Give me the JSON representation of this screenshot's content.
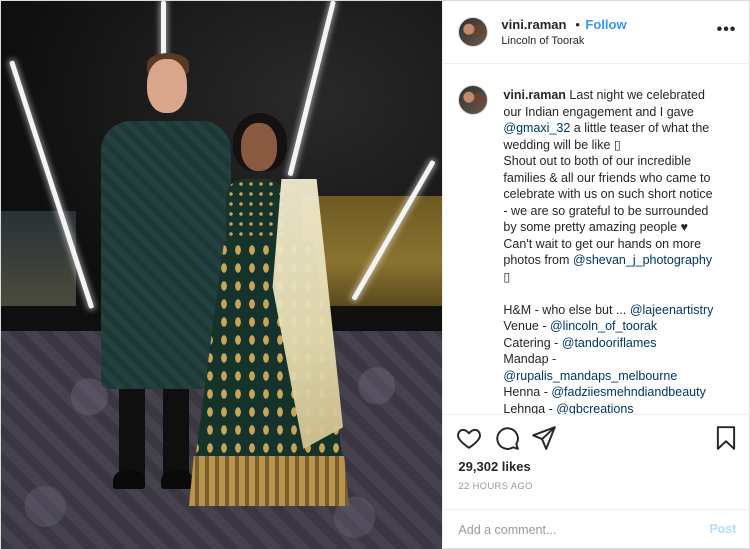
{
  "header": {
    "username": "vini.raman",
    "separator": "•",
    "follow_label": "Follow",
    "location": "Lincoln of Toorak",
    "more_glyph": "•••"
  },
  "caption": {
    "username": "vini.raman",
    "lines": [
      {
        "text": " Last night we celebrated"
      },
      {
        "text": "our Indian engagement and I gave"
      },
      {
        "mention": "@gmaxi_32",
        "text": " a little teaser of what the"
      },
      {
        "text": "wedding will be like ▯"
      },
      {
        "text": "Shout out to both of our incredible"
      },
      {
        "text": "families & all our friends who came to"
      },
      {
        "text": "celebrate with us on such short notice"
      },
      {
        "text": "- we are so grateful to be surrounded"
      },
      {
        "text": "by some pretty amazing people ♥"
      },
      {
        "text": "Can't wait to get our hands on more"
      },
      {
        "text": "photos from ",
        "mention": "@shevan_j_photography"
      },
      {
        "text": "▯"
      },
      {
        "text": ""
      },
      {
        "text": "H&M - who else but ... ",
        "mention": "@lajeenartistry"
      },
      {
        "text": "Venue - ",
        "mention": "@lincoln_of_toorak"
      },
      {
        "text": "Catering - ",
        "mention": "@tandooriflames"
      },
      {
        "text": "Mandap -"
      },
      {
        "text": "",
        "mention": "@rupalis_mandaps_melbourne"
      },
      {
        "text": "Henna - ",
        "mention": "@fadziiesmehndiandbeauty"
      },
      {
        "text": "Lehnga - ",
        "mention": "@gbcreations"
      }
    ]
  },
  "post": {
    "likes": "29,302 likes",
    "time": "22 HOURS AGO"
  },
  "comment": {
    "placeholder": "Add a comment...",
    "post_label": "Post"
  },
  "icons": [
    "heart-icon",
    "comment-icon",
    "share-icon",
    "bookmark-icon",
    "more-icon"
  ],
  "colors": {
    "link": "#003569",
    "follow": "#3897f0",
    "post_disabled": "#b2dffc",
    "muted": "#999999"
  }
}
